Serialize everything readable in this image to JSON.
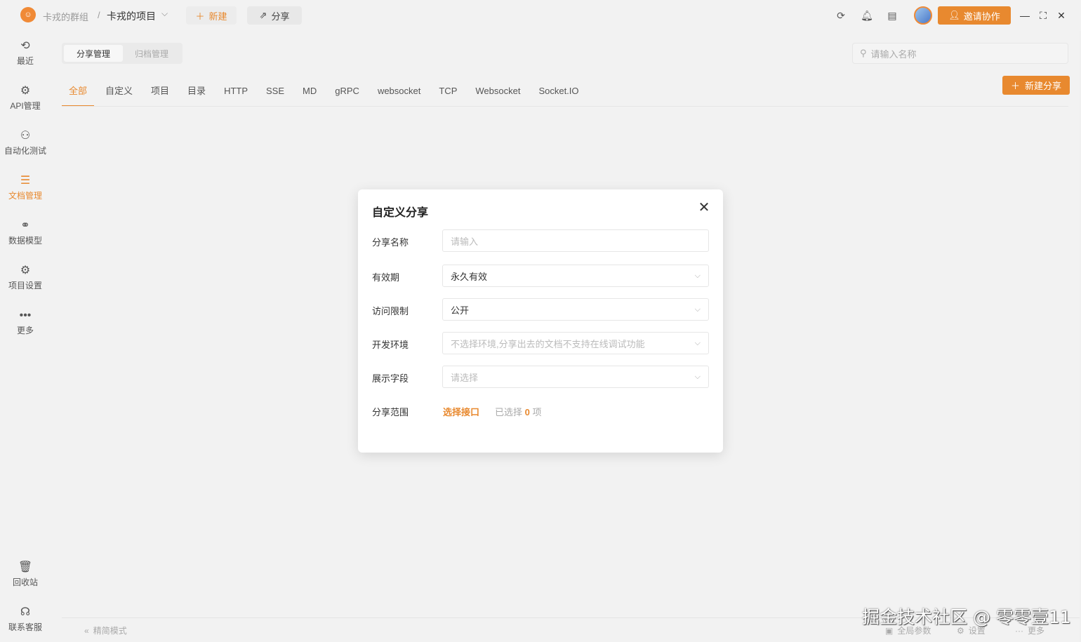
{
  "titlebar": {
    "team": "卡戎的群组",
    "separator": "/",
    "project": "卡戎的项目",
    "new_label": "新建",
    "share_label": "分享",
    "invite_label": "邀请协作",
    "icons": [
      "refresh-icon",
      "bell-icon",
      "list-icon"
    ]
  },
  "sidebar": {
    "items": [
      {
        "label": "最近",
        "icon": "⟲"
      },
      {
        "label": "API管理",
        "icon": "⚙"
      },
      {
        "label": "自动化测试",
        "icon": "⚇"
      },
      {
        "label": "文档管理",
        "icon": "☰"
      },
      {
        "label": "数据模型",
        "icon": "⚭"
      },
      {
        "label": "项目设置",
        "icon": "⚙"
      },
      {
        "label": "更多",
        "icon": "•••"
      }
    ],
    "bottom": [
      {
        "label": "回收站",
        "icon": "🗑"
      },
      {
        "label": "联系客服",
        "icon": "☊"
      }
    ]
  },
  "main": {
    "segment": {
      "active": "分享管理",
      "inactive": "归档管理"
    },
    "search_placeholder": "请输入名称",
    "tabs": [
      "全部",
      "自定义",
      "项目",
      "目录",
      "HTTP",
      "SSE",
      "MD",
      "gRPC",
      "websocket",
      "TCP",
      "Websocket",
      "Socket.IO"
    ],
    "create_label": "新建分享"
  },
  "footer": {
    "simple_mode": "精简模式",
    "global_params": "全局参数",
    "settings": "设置",
    "more": "更多"
  },
  "watermark": "掘金技术社区 @ 零零壹11",
  "modal": {
    "title": "自定义分享",
    "fields": {
      "name": {
        "label": "分享名称",
        "placeholder": "请输入"
      },
      "expiry": {
        "label": "有效期",
        "value": "永久有效"
      },
      "access": {
        "label": "访问限制",
        "value": "公开"
      },
      "env": {
        "label": "开发环境",
        "placeholder": "不选择环境,分享出去的文档不支持在线调试功能"
      },
      "display": {
        "label": "展示字段",
        "placeholder": "请选择"
      }
    },
    "range": {
      "label": "分享范围",
      "link": "选择接口",
      "selected_prefix": "已选择",
      "selected_count": "0",
      "selected_suffix": "项"
    }
  },
  "colors": {
    "accent": "#e8892f",
    "bg": "#f2f2f2"
  }
}
